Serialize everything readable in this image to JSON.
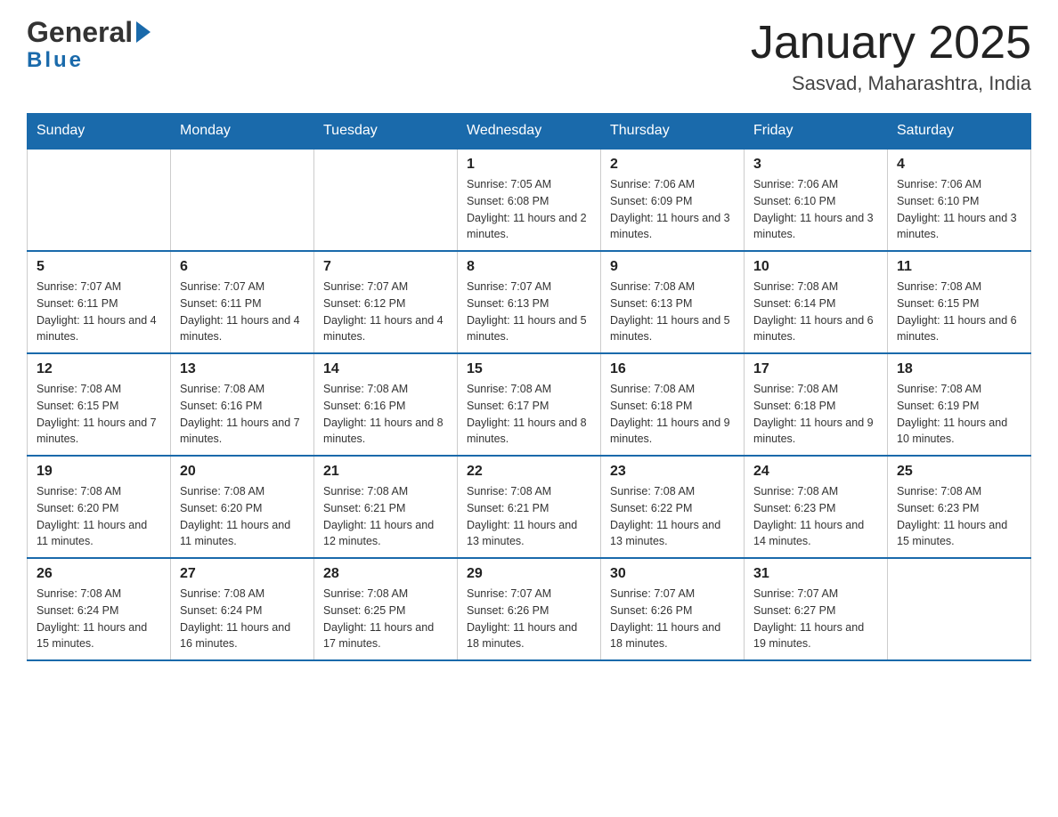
{
  "header": {
    "title": "January 2025",
    "subtitle": "Sasvad, Maharashtra, India",
    "logo_general": "General",
    "logo_blue": "Blue"
  },
  "calendar": {
    "days_of_week": [
      "Sunday",
      "Monday",
      "Tuesday",
      "Wednesday",
      "Thursday",
      "Friday",
      "Saturday"
    ],
    "weeks": [
      [
        {
          "day": "",
          "info": ""
        },
        {
          "day": "",
          "info": ""
        },
        {
          "day": "",
          "info": ""
        },
        {
          "day": "1",
          "info": "Sunrise: 7:05 AM\nSunset: 6:08 PM\nDaylight: 11 hours\nand 2 minutes."
        },
        {
          "day": "2",
          "info": "Sunrise: 7:06 AM\nSunset: 6:09 PM\nDaylight: 11 hours\nand 3 minutes."
        },
        {
          "day": "3",
          "info": "Sunrise: 7:06 AM\nSunset: 6:10 PM\nDaylight: 11 hours\nand 3 minutes."
        },
        {
          "day": "4",
          "info": "Sunrise: 7:06 AM\nSunset: 6:10 PM\nDaylight: 11 hours\nand 3 minutes."
        }
      ],
      [
        {
          "day": "5",
          "info": "Sunrise: 7:07 AM\nSunset: 6:11 PM\nDaylight: 11 hours\nand 4 minutes."
        },
        {
          "day": "6",
          "info": "Sunrise: 7:07 AM\nSunset: 6:11 PM\nDaylight: 11 hours\nand 4 minutes."
        },
        {
          "day": "7",
          "info": "Sunrise: 7:07 AM\nSunset: 6:12 PM\nDaylight: 11 hours\nand 4 minutes."
        },
        {
          "day": "8",
          "info": "Sunrise: 7:07 AM\nSunset: 6:13 PM\nDaylight: 11 hours\nand 5 minutes."
        },
        {
          "day": "9",
          "info": "Sunrise: 7:08 AM\nSunset: 6:13 PM\nDaylight: 11 hours\nand 5 minutes."
        },
        {
          "day": "10",
          "info": "Sunrise: 7:08 AM\nSunset: 6:14 PM\nDaylight: 11 hours\nand 6 minutes."
        },
        {
          "day": "11",
          "info": "Sunrise: 7:08 AM\nSunset: 6:15 PM\nDaylight: 11 hours\nand 6 minutes."
        }
      ],
      [
        {
          "day": "12",
          "info": "Sunrise: 7:08 AM\nSunset: 6:15 PM\nDaylight: 11 hours\nand 7 minutes."
        },
        {
          "day": "13",
          "info": "Sunrise: 7:08 AM\nSunset: 6:16 PM\nDaylight: 11 hours\nand 7 minutes."
        },
        {
          "day": "14",
          "info": "Sunrise: 7:08 AM\nSunset: 6:16 PM\nDaylight: 11 hours\nand 8 minutes."
        },
        {
          "day": "15",
          "info": "Sunrise: 7:08 AM\nSunset: 6:17 PM\nDaylight: 11 hours\nand 8 minutes."
        },
        {
          "day": "16",
          "info": "Sunrise: 7:08 AM\nSunset: 6:18 PM\nDaylight: 11 hours\nand 9 minutes."
        },
        {
          "day": "17",
          "info": "Sunrise: 7:08 AM\nSunset: 6:18 PM\nDaylight: 11 hours\nand 9 minutes."
        },
        {
          "day": "18",
          "info": "Sunrise: 7:08 AM\nSunset: 6:19 PM\nDaylight: 11 hours\nand 10 minutes."
        }
      ],
      [
        {
          "day": "19",
          "info": "Sunrise: 7:08 AM\nSunset: 6:20 PM\nDaylight: 11 hours\nand 11 minutes."
        },
        {
          "day": "20",
          "info": "Sunrise: 7:08 AM\nSunset: 6:20 PM\nDaylight: 11 hours\nand 11 minutes."
        },
        {
          "day": "21",
          "info": "Sunrise: 7:08 AM\nSunset: 6:21 PM\nDaylight: 11 hours\nand 12 minutes."
        },
        {
          "day": "22",
          "info": "Sunrise: 7:08 AM\nSunset: 6:21 PM\nDaylight: 11 hours\nand 13 minutes."
        },
        {
          "day": "23",
          "info": "Sunrise: 7:08 AM\nSunset: 6:22 PM\nDaylight: 11 hours\nand 13 minutes."
        },
        {
          "day": "24",
          "info": "Sunrise: 7:08 AM\nSunset: 6:23 PM\nDaylight: 11 hours\nand 14 minutes."
        },
        {
          "day": "25",
          "info": "Sunrise: 7:08 AM\nSunset: 6:23 PM\nDaylight: 11 hours\nand 15 minutes."
        }
      ],
      [
        {
          "day": "26",
          "info": "Sunrise: 7:08 AM\nSunset: 6:24 PM\nDaylight: 11 hours\nand 15 minutes."
        },
        {
          "day": "27",
          "info": "Sunrise: 7:08 AM\nSunset: 6:24 PM\nDaylight: 11 hours\nand 16 minutes."
        },
        {
          "day": "28",
          "info": "Sunrise: 7:08 AM\nSunset: 6:25 PM\nDaylight: 11 hours\nand 17 minutes."
        },
        {
          "day": "29",
          "info": "Sunrise: 7:07 AM\nSunset: 6:26 PM\nDaylight: 11 hours\nand 18 minutes."
        },
        {
          "day": "30",
          "info": "Sunrise: 7:07 AM\nSunset: 6:26 PM\nDaylight: 11 hours\nand 18 minutes."
        },
        {
          "day": "31",
          "info": "Sunrise: 7:07 AM\nSunset: 6:27 PM\nDaylight: 11 hours\nand 19 minutes."
        },
        {
          "day": "",
          "info": ""
        }
      ]
    ]
  }
}
